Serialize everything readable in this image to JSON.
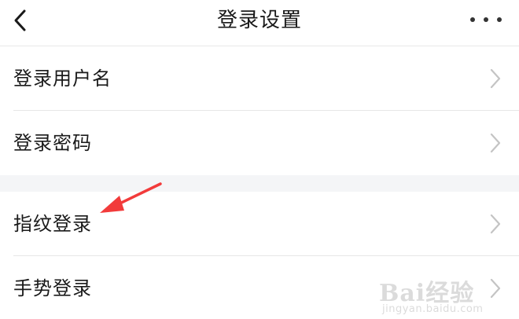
{
  "header": {
    "title": "登录设置",
    "back_icon": "chevron-left-icon",
    "more_icon": "more-horizontal-icon"
  },
  "groups": [
    {
      "items": [
        {
          "label": "登录用户名",
          "icon": "chevron-right-icon"
        },
        {
          "label": "登录密码",
          "icon": "chevron-right-icon"
        }
      ]
    },
    {
      "items": [
        {
          "label": "指纹登录",
          "icon": "chevron-right-icon"
        },
        {
          "label": "手势登录",
          "icon": "chevron-right-icon"
        }
      ]
    }
  ],
  "annotation": {
    "color": "#f23b3b"
  },
  "watermark": {
    "main": "Bai经验",
    "sub": "jingyan.baidu.com"
  },
  "colors": {
    "background": "#ffffff",
    "section_gap": "#f4f5f7",
    "divider": "#e6e6e6",
    "chevron": "#c4c4c4",
    "text": "#1a1a1a"
  }
}
